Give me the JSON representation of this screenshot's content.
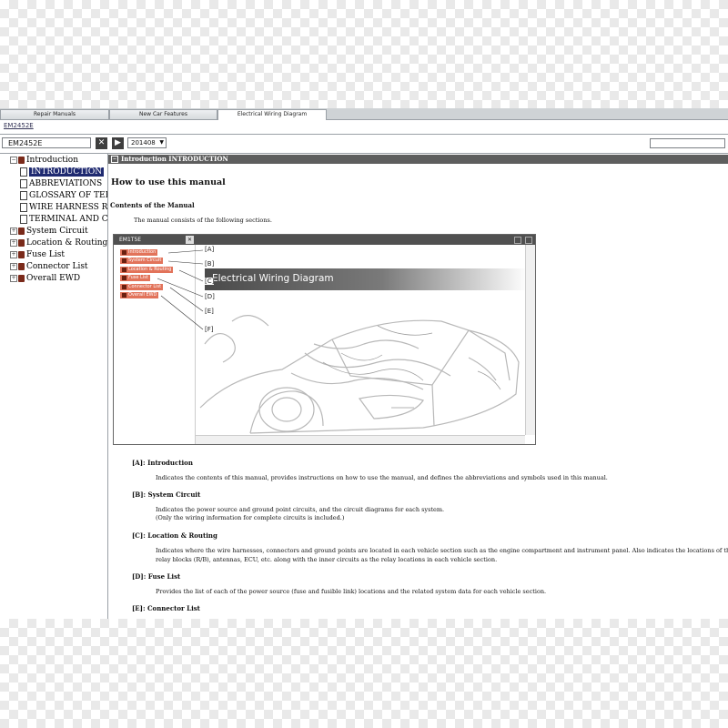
{
  "tabs": [
    "Repair Manuals",
    "New Car Features",
    "Electrical Wiring Diagram"
  ],
  "breadcrumb": "EM2452E",
  "toolbar": {
    "doc_id": "EM2452E",
    "close_icon": "✕",
    "next_icon": "▶",
    "version": "201408",
    "dropdown_icon": "▼"
  },
  "tree": {
    "introduction": "Introduction",
    "children": [
      "INTRODUCTION",
      "ABBREVIATIONS",
      "GLOSSARY OF TER",
      "WIRE HARNESS RE",
      "TERMINAL AND CC"
    ],
    "sections": [
      "System Circuit",
      "Location & Routing",
      "Fuse List",
      "Connector List",
      "Overall EWD"
    ]
  },
  "content": {
    "header": "Introduction  INTRODUCTION",
    "title": "How to use this manual",
    "contents_heading": "Contents of the Manual",
    "lead": "The manual consists of the following sections.",
    "screenshot": {
      "title": "EM1T5E",
      "items": [
        "Introduction",
        "System Circuit",
        "Location & Routing",
        "Fuse List",
        "Connector List",
        "Overall EWD"
      ],
      "labels": [
        "[A]",
        "[B]",
        "[C]",
        "[D]",
        "[E]",
        "[F]"
      ],
      "banner": "Electrical Wiring Diagram"
    },
    "sections": [
      {
        "heading": "[A]: Introduction",
        "lines": [
          "Indicates the contents of this manual, provides instructions on how to use the manual, and defines the abbreviations and symbols used in this manual."
        ]
      },
      {
        "heading": "[B]: System Circuit",
        "lines": [
          "Indicates the power source and ground point circuits, and the circuit diagrams for each system.",
          "(Only the wiring information for complete circuits is included.)"
        ]
      },
      {
        "heading": "[C]: Location & Routing",
        "lines": [
          "Indicates where the wire harnesses, connectors and ground points are located in each vehicle section such as the engine compartment and instrument panel. Also indicates the locations of the",
          "relay blocks (R/B), antennas, ECU, etc. along with the inner circuits as the relay locations in each vehicle section."
        ]
      },
      {
        "heading": "[D]: Fuse List",
        "lines": [
          "Provides the list of each of the power source (fuse and fusible link) locations and the related system data for each vehicle section."
        ]
      },
      {
        "heading": "[E]: Connector List",
        "lines": []
      }
    ]
  }
}
